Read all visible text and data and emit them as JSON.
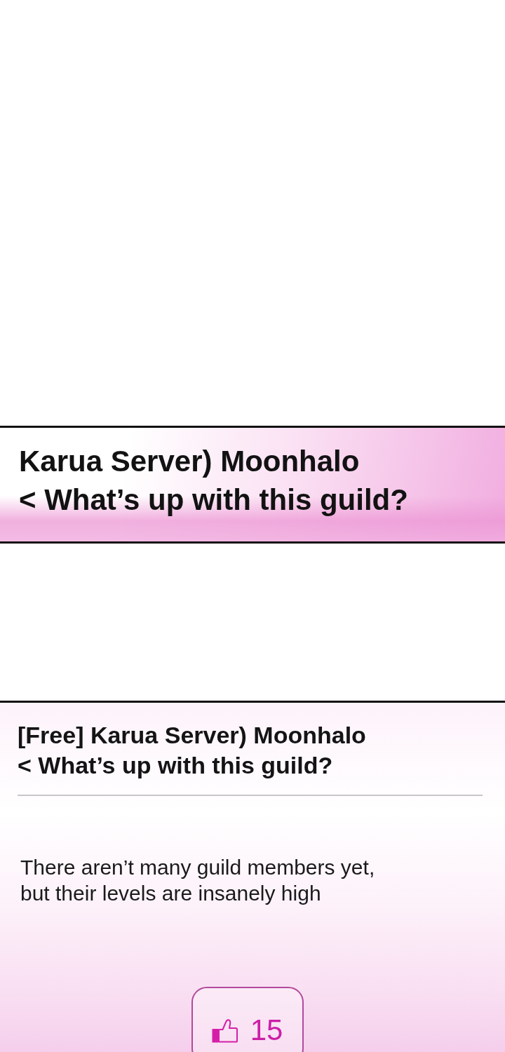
{
  "panels": [
    {
      "kind": "banner",
      "title": "Karua Server) Moonhalo",
      "subtitle": "< What’s up with this guild?"
    },
    {
      "kind": "post",
      "title": "[Free] Karua Server) Moonhalo",
      "subtitle": "< What’s up with this guild?",
      "body": "There aren’t many guild members yet,\nbut their levels are insanely high",
      "likes": "15"
    }
  ]
}
